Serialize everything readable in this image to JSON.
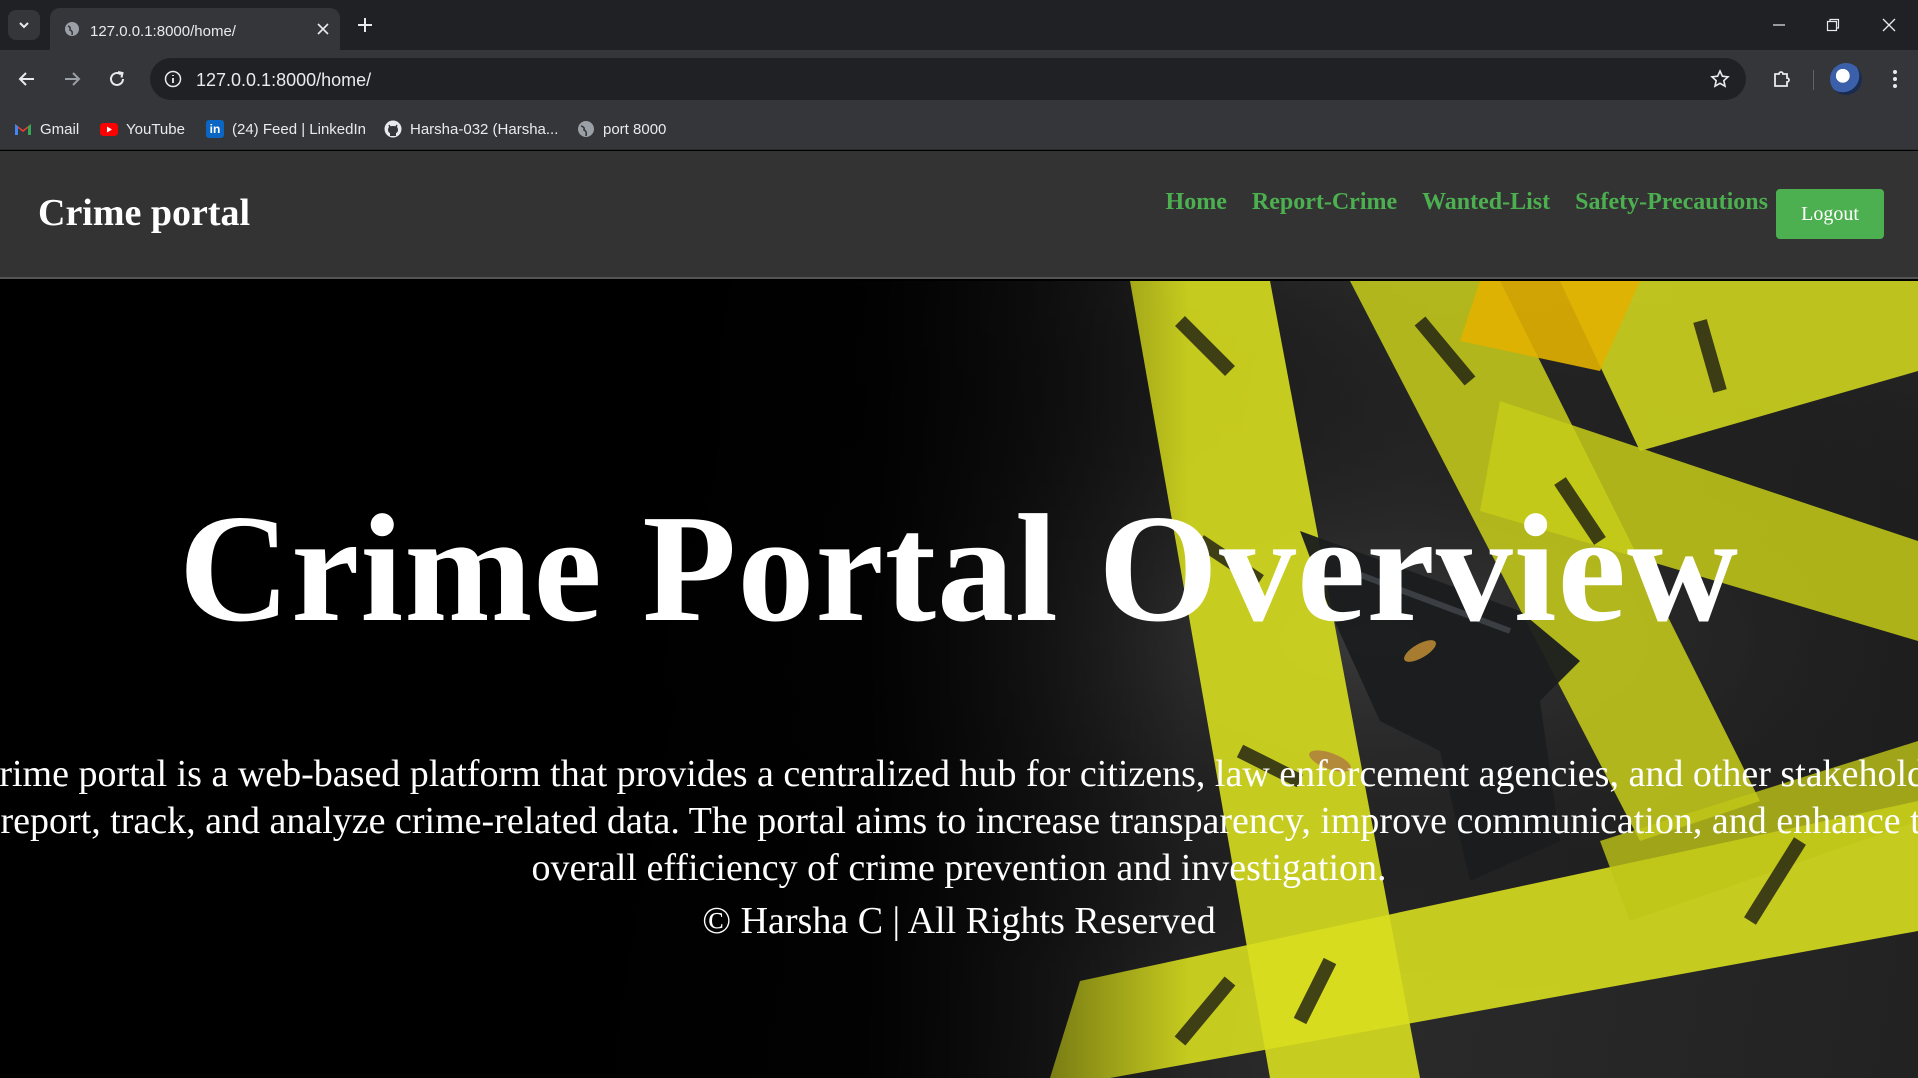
{
  "browser": {
    "tab": {
      "title": "127.0.0.1:8000/home/"
    },
    "address_bar": {
      "url": "127.0.0.1:8000/home/"
    },
    "bookmarks": [
      {
        "label": "Gmail",
        "icon": "gmail-icon"
      },
      {
        "label": "YouTube",
        "icon": "youtube-icon"
      },
      {
        "label": "(24) Feed | LinkedIn",
        "icon": "linkedin-icon"
      },
      {
        "label": "Harsha-032 (Harsha...",
        "icon": "github-icon"
      },
      {
        "label": "port 8000",
        "icon": "globe-icon"
      }
    ]
  },
  "navbar": {
    "brand": "Crime portal",
    "links": [
      "Home",
      "Report-Crime",
      "Wanted-List",
      "Safety-Precautions"
    ],
    "logout_label": "Logout"
  },
  "hero": {
    "title": "Crime Portal Overview",
    "description": "A crime portal is a web-based platform that provides a centralized hub for citizens, law enforcement agencies, and other stakeholders to report, track, and analyze crime-related data. The portal aims to increase transparency, improve communication, and enhance the overall efficiency of crime prevention and investigation.",
    "footer": "© Harsha C | All Rights Reserved"
  },
  "colors": {
    "accent_green": "#4caf50",
    "navbar_bg": "#333333",
    "tape_yellow": "#d8de1f"
  }
}
